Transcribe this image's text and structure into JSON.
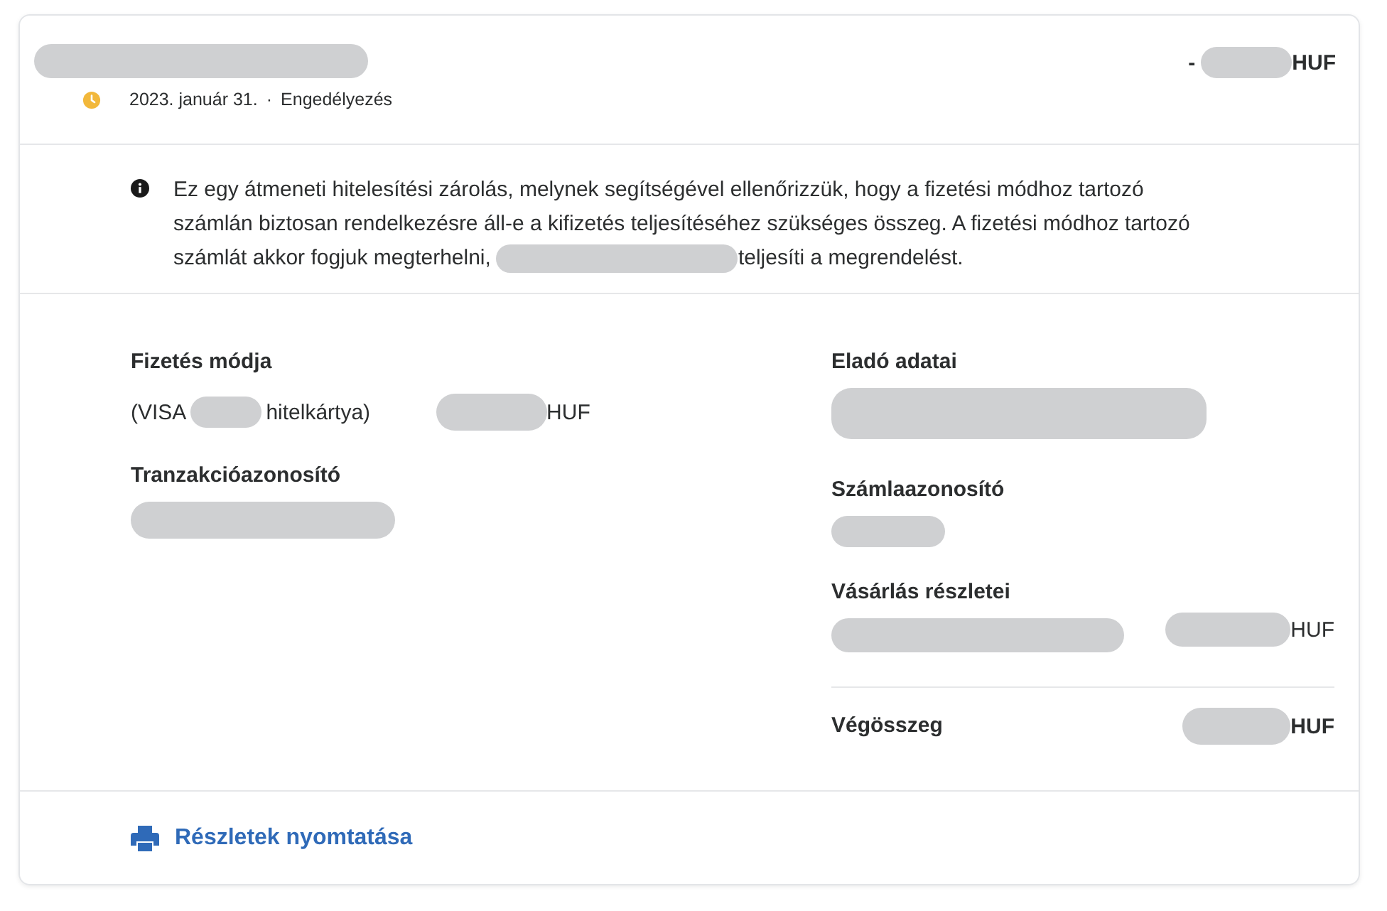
{
  "header": {
    "amount_sign": "-",
    "amount_currency": "HUF",
    "date": "2023. január 31.",
    "separator": "·",
    "status": "Engedélyezés"
  },
  "notice": {
    "lines": [
      "Ez egy átmeneti hitelesítési zárolás, melynek segítségével ellenőrizzük, hogy a fizetési módhoz tartozó",
      "számlán biztosan rendelkezésre áll-e a kifizetés teljesítéséhez szükséges összeg. A fizetési módhoz tartozó",
      "számlát akkor fogjuk megterhelni,"
    ],
    "text_after": "teljesíti a megrendelést."
  },
  "payment": {
    "label": "Fizetés módja",
    "card_prefix": "(VISA",
    "card_suffix": "hitelkártya)",
    "currency": "HUF"
  },
  "transaction": {
    "label": "Tranzakcióazonosító"
  },
  "seller": {
    "label": "Eladó adatai"
  },
  "invoice": {
    "label": "Számlaazonosító"
  },
  "purchase": {
    "label": "Vásárlás részletei",
    "currency": "HUF"
  },
  "total": {
    "label": "Végösszeg",
    "currency": "HUF"
  },
  "print_link": "Részletek nyomtatása"
}
